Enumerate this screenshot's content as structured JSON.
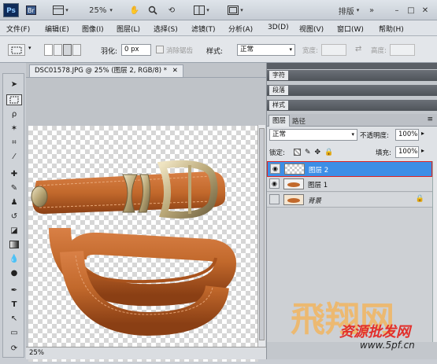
{
  "appbar": {
    "logo": "Ps",
    "zoom": "25%",
    "workspace": "排版"
  },
  "menu": [
    "文件(F)",
    "编辑(E)",
    "图像(I)",
    "图层(L)",
    "选择(S)",
    "滤镜(T)",
    "分析(A)",
    "3D(D)",
    "视图(V)",
    "窗口(W)",
    "帮助(H)"
  ],
  "options": {
    "feather_label": "羽化:",
    "feather_value": "0 px",
    "antialias": "消除锯齿",
    "style_label": "样式:",
    "style_value": "正常",
    "width_label": "宽度:",
    "height_label": "高度:"
  },
  "document": {
    "tab_title": "DSC01578.JPG @ 25% (图层 2, RGB/8) *",
    "zoom_status": "25%"
  },
  "panels": {
    "char": "字符",
    "para": "段落",
    "styles": "样式",
    "tabs": {
      "layers": "图层",
      "paths": "路径"
    },
    "blend_mode": "正常",
    "opacity_label": "不透明度:",
    "opacity": "100%",
    "lock_label": "锁定:",
    "fill_label": "填充:",
    "fill": "100%",
    "layers": [
      {
        "name": "图层 2",
        "selected": true
      },
      {
        "name": "图层 1",
        "selected": false
      },
      {
        "name": "背景",
        "selected": false
      }
    ]
  },
  "watermark": {
    "brand": "飛翔网",
    "tagline": "资源批发网",
    "url": "www.5pf.cn"
  },
  "colors": {
    "selection": "#3d8ee6",
    "belt": "#c2692c",
    "belt_dark": "#8a3f14",
    "metal": "#c9b98f",
    "watermark": "#f2b560"
  }
}
